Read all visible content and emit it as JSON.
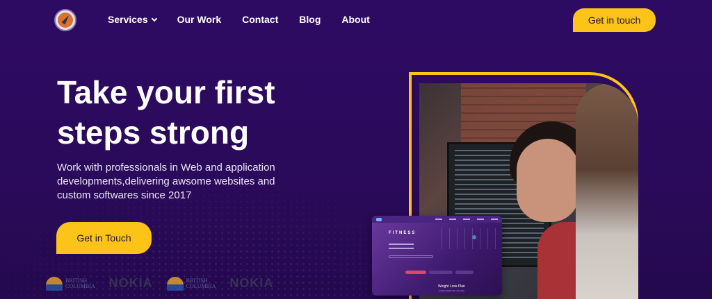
{
  "nav": {
    "items": [
      {
        "label": "Services",
        "dropdown": true
      },
      {
        "label": "Our Work"
      },
      {
        "label": "Contact"
      },
      {
        "label": "Blog"
      },
      {
        "label": "About"
      }
    ],
    "cta_label": "Get in touch"
  },
  "hero": {
    "title": "Take your first steps strong",
    "subtitle": "Work with professionals in Web and application developments,delivering awsome websites and custom softwares since 2017",
    "cta_label": "Get in Touch"
  },
  "clients": [
    {
      "name": "British Columbia",
      "line1": "BRITISH",
      "line2": "COLUMBIA"
    },
    {
      "name": "NOKIA"
    },
    {
      "name": "British Columbia",
      "line1": "BRITISH",
      "line2": "COLUMBIA"
    },
    {
      "name": "NOKIA"
    }
  ],
  "mockup": {
    "title": "FITNESS",
    "plan_title": "Weight Loss Plan",
    "plan_subtitle": "Losing weight the easy way"
  },
  "colors": {
    "background": "#2c0a5e",
    "accent": "#fcc419"
  }
}
